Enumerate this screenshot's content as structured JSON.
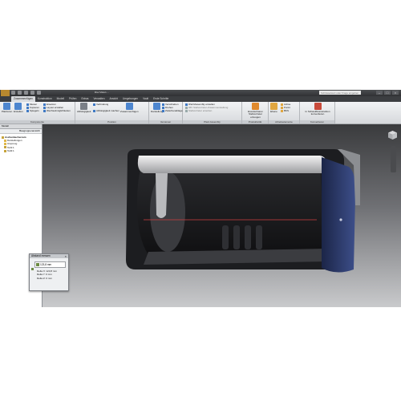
{
  "app": {
    "document_title": "Drei Vision ...",
    "help_search_placeholder": "Schlüsselwort oder Frage eingeben",
    "window_controls": [
      "–",
      "□",
      "×"
    ]
  },
  "tabs": [
    "Zusammenfügen",
    "Konstruktion",
    "Modell",
    "Prüfen",
    "Extras",
    "Verwalten",
    "Ansicht",
    "Umgebungen",
    "Vault",
    "Erste Schritte"
  ],
  "active_tab": "Zusammenfügen",
  "ribbon": {
    "panels": [
      {
        "title": "Komponente",
        "commands": [
          "Platzieren",
          "Erstellen",
          "Muster",
          "Kopieren",
          "Spiegeln",
          "Ersetzen",
          "Layout erstellen",
          "Wechselmöglichkeiten"
        ]
      },
      {
        "title": "Position",
        "commands": [
          "Abhängigkeit",
          "Verbindung",
          "Abhängigkeit machen",
          "Zusammenfügen"
        ]
      },
      {
        "title": "Versionen",
        "commands": [
          "Darstellung",
          "Verschieben",
          "Drehen",
          "Zwischenablage",
          "Bewegen",
          "Freigeben"
        ]
      },
      {
        "title": "Plant Assembly",
        "commands": [
          "iPart/iAssembly erstellen",
          "iMV Stellvertreter-Zusammenstellung",
          "Stellvertreter ersetzen"
        ]
      },
      {
        "title": "Produktivität",
        "commands": [
          "Erweiterbaren Stellvertreter erzeugen"
        ]
      },
      {
        "title": "Arbeitselemente",
        "commands": [
          "Ebene",
          "Achse",
          "Punkt",
          "BKS"
        ]
      },
      {
        "title": "Konvertieren",
        "commands": [
          "In Schweißkonstruktion konvertieren"
        ]
      }
    ]
  },
  "browser": {
    "title": "Modell",
    "dropdown": "Baugruppenansicht",
    "items": [
      {
        "label": "Aschenbecher.iam",
        "icon": "assembly-icon",
        "color": "#c7a43b"
      },
      {
        "label": "Darstellungen",
        "icon": "folder-icon",
        "color": "#e0b84a"
      },
      {
        "label": "Ursprung",
        "icon": "folder-icon",
        "color": "#e0b84a"
      },
      {
        "label": "Teil1:1",
        "icon": "part-icon",
        "color": "#c7a43b"
      },
      {
        "label": "Teil2:1",
        "icon": "part-icon",
        "color": "#c7a43b"
      }
    ]
  },
  "measure_dialog": {
    "title": "Abstand messen",
    "value": "123,8 mm",
    "deltas": [
      "Delta X: 123,8 mm",
      "Delta Y: 0 mm",
      "Delta Z: 0 mm"
    ]
  },
  "viewport": {
    "model_colors": {
      "body": "#1f2023",
      "lid_highlight": "#e8e8e8",
      "side_panel": "#2d3a66",
      "measure_line": "#d04040"
    }
  }
}
